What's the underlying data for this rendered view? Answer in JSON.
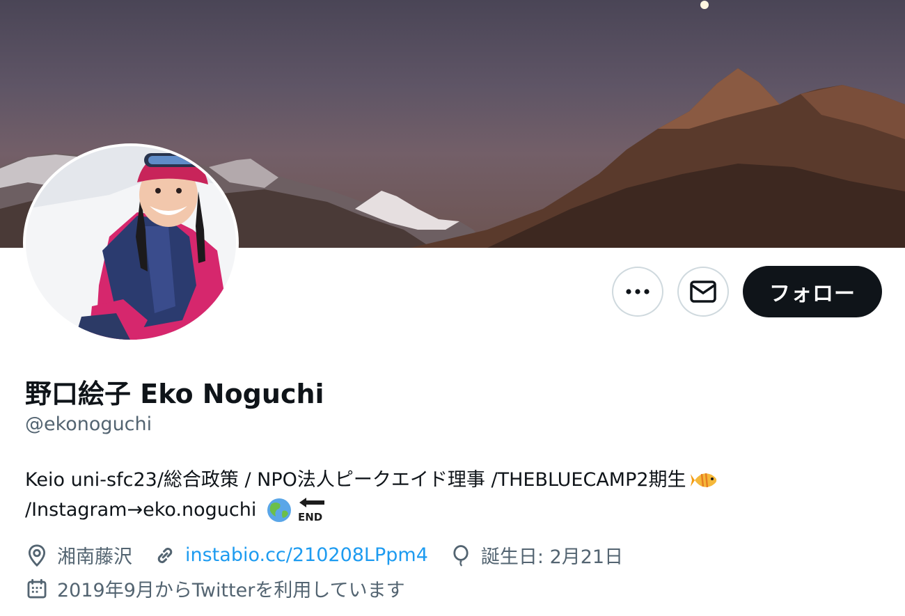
{
  "profile": {
    "display_name": "野口絵子 Eko Noguchi",
    "handle": "@ekonoguchi",
    "bio_line1": "Keio uni-sfc23/総合政策 / NPO法人ピークエイド理事 /THEBLUECAMP2期生",
    "bio_line2": "/Instagram→eko.noguchi",
    "bio_emojis": [
      "tropical-fish-emoji",
      "earth-globe-emoji",
      "end-arrow-emoji"
    ],
    "location": "湘南藤沢",
    "website": "instabio.cc/210208LPpm4",
    "birthday": "誕生日: 2月21日",
    "joined": "2019年9月からTwitterを利用しています"
  },
  "actions": {
    "more_label": "…",
    "follow_label": "フォロー"
  },
  "icons": [
    "more-icon",
    "message-icon",
    "location-icon",
    "link-icon",
    "balloon-icon",
    "calendar-icon"
  ],
  "colors": {
    "text_primary": "#0f1419",
    "text_secondary": "#536471",
    "link": "#1d9bf0",
    "follow_button": "#0f1419"
  }
}
